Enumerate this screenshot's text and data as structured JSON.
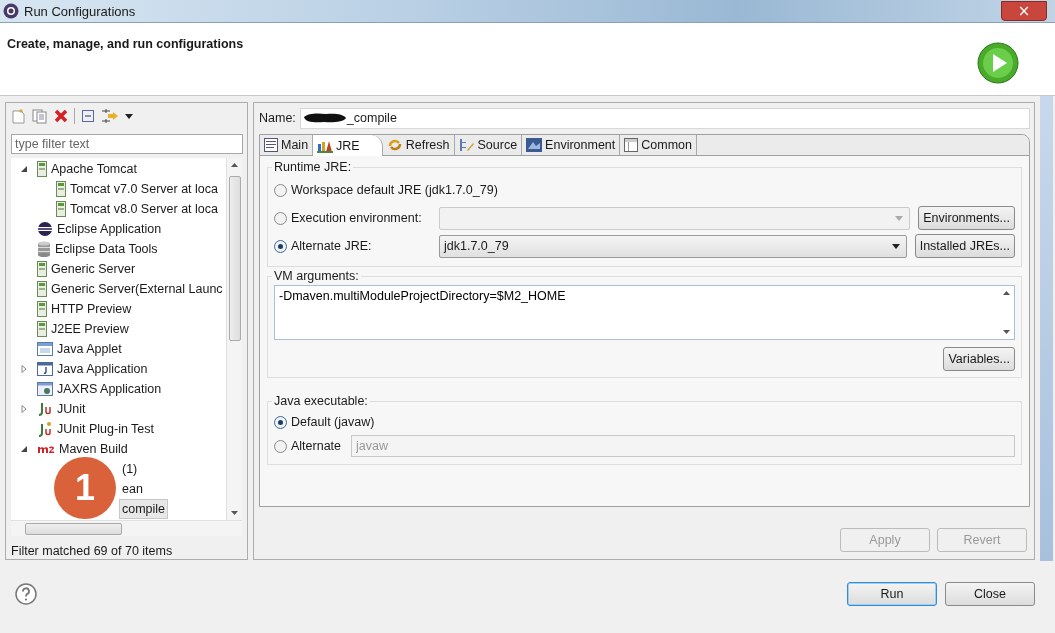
{
  "window": {
    "title": "Run Configurations",
    "close": "×"
  },
  "header": {
    "title": "Create, manage, and run configurations"
  },
  "left": {
    "filter": {
      "placeholder": "type filter text"
    },
    "tree": [
      {
        "label": "Apache Tomcat",
        "kind": "server",
        "expanded": true,
        "selected": false,
        "children": [
          {
            "label": "Tomcat v7.0 Server at loca",
            "kind": "server",
            "selected": false
          },
          {
            "label": "Tomcat v8.0 Server at loca",
            "kind": "server",
            "selected": false
          }
        ]
      },
      {
        "label": "Eclipse Application",
        "kind": "eclipse",
        "selected": false
      },
      {
        "label": "Eclipse Data Tools",
        "kind": "database",
        "selected": false
      },
      {
        "label": "Generic Server",
        "kind": "server",
        "selected": false
      },
      {
        "label": "Generic Server(External Launc",
        "kind": "server",
        "selected": false
      },
      {
        "label": "HTTP Preview",
        "kind": "server",
        "selected": false
      },
      {
        "label": "J2EE Preview",
        "kind": "server",
        "selected": false
      },
      {
        "label": "Java Applet",
        "kind": "applet",
        "selected": false
      },
      {
        "label": "Java Application",
        "kind": "java",
        "expanded": false,
        "selected": false
      },
      {
        "label": "JAXRS Application",
        "kind": "jaxrs",
        "selected": false
      },
      {
        "label": "JUnit",
        "kind": "junit",
        "expanded": false,
        "selected": false
      },
      {
        "label": "JUnit Plug-in Test",
        "kind": "plugin",
        "selected": false
      },
      {
        "label": "Maven Build",
        "kind": "maven",
        "expanded": true,
        "selected": false,
        "children": [
          {
            "label": "(1)",
            "kind": "maven-run",
            "selected": false
          },
          {
            "label": "ean",
            "kind": "maven-run",
            "selected": false
          },
          {
            "label": "compile",
            "kind": "maven-run",
            "selected": true
          }
        ]
      }
    ],
    "status": "Filter matched 69 of 70 items"
  },
  "annotation": {
    "label": "1"
  },
  "name": {
    "label": "Name:",
    "value": "_compile",
    "redacted": true
  },
  "tabs": [
    {
      "label": "Main",
      "kind": "main",
      "selected": false
    },
    {
      "label": "JRE",
      "kind": "jre",
      "selected": true
    },
    {
      "label": "Refresh",
      "kind": "refresh",
      "selected": false
    },
    {
      "label": "Source",
      "kind": "source",
      "selected": false
    },
    {
      "label": "Environment",
      "kind": "environment",
      "selected": false
    },
    {
      "label": "Common",
      "kind": "common",
      "selected": false
    }
  ],
  "runtime_jre": {
    "title": "Runtime JRE:",
    "options": [
      {
        "label": "Workspace default JRE (jdk1.7.0_79)",
        "kind": "plain",
        "selected": false
      },
      {
        "label": "Execution environment:",
        "kind": "combo",
        "disabled": true,
        "button": "Environments...",
        "selected": false
      },
      {
        "label": "Alternate JRE:",
        "kind": "combo",
        "value": "jdk1.7.0_79",
        "disabled": false,
        "button": "Installed JREs...",
        "selected": true
      }
    ]
  },
  "vm_arguments": {
    "title": "VM arguments:",
    "value": "-Dmaven.multiModuleProjectDirectory=$M2_HOME",
    "button": "Variables..."
  },
  "java_executable": {
    "title": "Java executable:",
    "options": [
      {
        "label": "Default (javaw)",
        "kind": "plain",
        "selected": true
      },
      {
        "label": "Alternate",
        "kind": "field",
        "value": "javaw",
        "disabled": true,
        "selected": false
      }
    ]
  },
  "actions": [
    {
      "label": "Apply",
      "disabled": true
    },
    {
      "label": "Revert",
      "disabled": true
    }
  ],
  "footer": [
    {
      "label": "Run",
      "default": true
    },
    {
      "label": "Close",
      "default": false
    }
  ]
}
